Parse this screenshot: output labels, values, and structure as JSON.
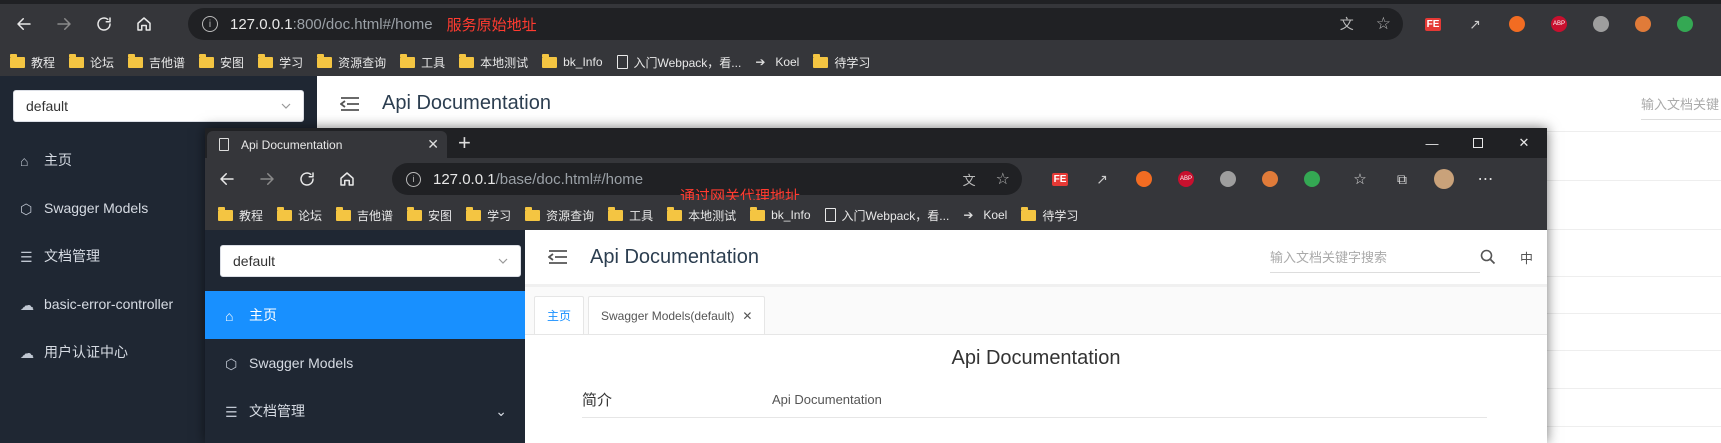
{
  "back_browser": {
    "url_host": "127.0.0.1",
    "url_rest": ":800/doc.html#/home",
    "annotation": "服务原始地址"
  },
  "front_browser": {
    "tab_title": "Api Documentation",
    "url_host": "127.0.0.1",
    "url_rest": "/base/doc.html#/home",
    "annotation": "通过网关代理地址"
  },
  "bookmarks": [
    {
      "type": "folder",
      "label": "教程"
    },
    {
      "type": "folder",
      "label": "论坛"
    },
    {
      "type": "folder",
      "label": "吉他谱"
    },
    {
      "type": "folder",
      "label": "安图"
    },
    {
      "type": "folder",
      "label": "学习"
    },
    {
      "type": "folder",
      "label": "资源查询"
    },
    {
      "type": "folder",
      "label": "工具"
    },
    {
      "type": "folder",
      "label": "本地测试"
    },
    {
      "type": "folder",
      "label": "bk_Info"
    },
    {
      "type": "page",
      "label": "入门Webpack，看..."
    },
    {
      "type": "bird",
      "label": "Koel"
    },
    {
      "type": "folder",
      "label": "待学习"
    }
  ],
  "extensions": {
    "fe": "FE",
    "abp": "ABP"
  },
  "back_app": {
    "group_select": "default",
    "title": "Api Documentation",
    "search_placeholder": "输入文档关键",
    "menu": [
      {
        "icon": "home-icon",
        "label": "主页"
      },
      {
        "icon": "cube-icon",
        "label": "Swagger Models"
      },
      {
        "icon": "doc-icon",
        "label": "文档管理"
      },
      {
        "icon": "cloud-icon",
        "label": "basic-error-controller"
      },
      {
        "icon": "cloud-icon",
        "label": "用户认证中心"
      }
    ]
  },
  "front_app": {
    "group_select": "default",
    "title": "Api Documentation",
    "search_placeholder": "输入文档关键字搜索",
    "lang": "中",
    "menu": [
      {
        "icon": "home-icon",
        "label": "主页",
        "active": true
      },
      {
        "icon": "cube-icon",
        "label": "Swagger Models"
      },
      {
        "icon": "doc-icon",
        "label": "文档管理"
      }
    ],
    "tabs": [
      {
        "label": "主页",
        "active": true
      },
      {
        "label": "Swagger Models(default)",
        "closable": true
      }
    ],
    "doc_heading": "Api Documentation",
    "intro_label": "简介",
    "intro_value": "Api Documentation"
  },
  "colors": {
    "chrome_dark": "#35363a",
    "sidebar": "#1f2733",
    "active": "#1890ff",
    "annotation": "#ff3b30"
  }
}
